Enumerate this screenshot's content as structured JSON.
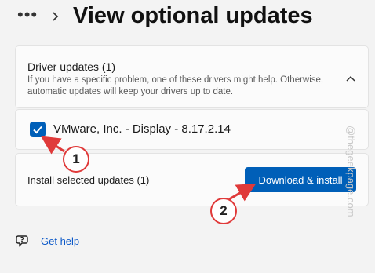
{
  "header": {
    "title": "View optional updates",
    "more_icon": "more-horizontal-icon",
    "chevron_icon": "chevron-right-icon"
  },
  "driver_updates": {
    "title": "Driver updates (1)",
    "description": "If you have a specific problem, one of these drivers might help. Otherwise, automatic updates will keep your drivers up to date.",
    "expanded": true,
    "items": [
      {
        "label": "VMware, Inc. - Display - 8.17.2.14",
        "checked": true
      }
    ]
  },
  "install": {
    "label": "Install selected updates (1)",
    "button_label": "Download & install"
  },
  "help": {
    "label": "Get help"
  },
  "watermark": "@thegeekpage.com",
  "annotations": [
    {
      "label": "1"
    },
    {
      "label": "2"
    }
  ],
  "colors": {
    "accent": "#005fb8",
    "annotation": "#e03a3a",
    "background": "#f3f3f3"
  }
}
